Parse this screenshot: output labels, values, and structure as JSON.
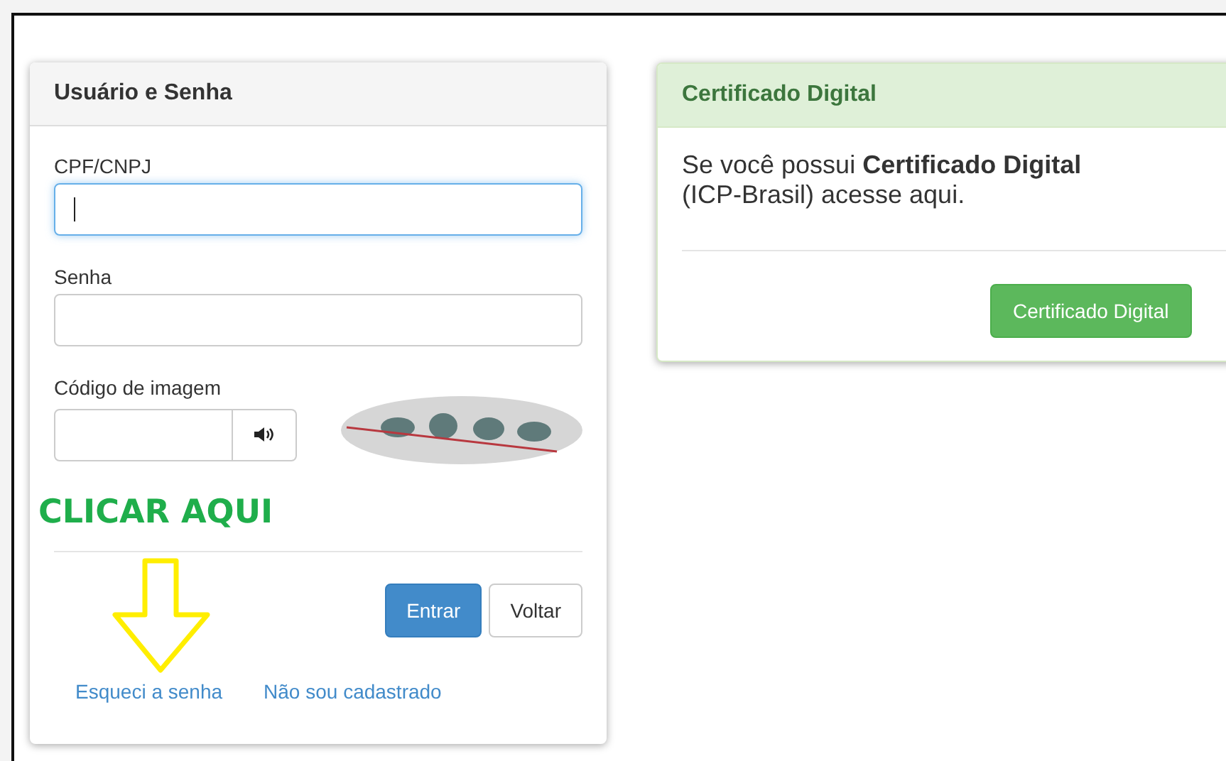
{
  "login_panel": {
    "title": "Usuário e Senha",
    "fields": [
      {
        "label": "CPF/CNPJ",
        "focused": true
      },
      {
        "label": "Senha",
        "focused": false
      }
    ],
    "captcha": {
      "label": "Código de imagem"
    },
    "buttons": [
      {
        "label": "Entrar",
        "primary": true
      },
      {
        "label": "Voltar",
        "primary": false
      }
    ],
    "links": [
      "Esqueci a senha",
      "Não sou cadastrado"
    ]
  },
  "annotation": {
    "text": "CLICAR AQUI"
  },
  "certificate_panel": {
    "title": "Certificado Digital",
    "text": "Se você possui **Certificado Digital** (ICP-Brasil) acesse aqui.",
    "button": "Certificado Digital"
  }
}
